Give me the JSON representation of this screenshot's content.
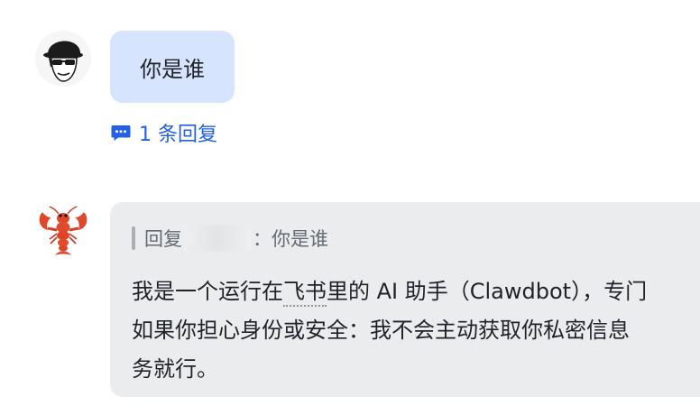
{
  "messages": {
    "user": {
      "avatar_icon": "user-avatar-sunglasses-hat-icon",
      "text": "你是谁",
      "reply_count_label": "1 条回复"
    },
    "bot": {
      "avatar_icon": "lobster-avatar-icon",
      "quote": {
        "prefix": "回复",
        "suffix": "：你是谁"
      },
      "lines": [
        {
          "before": "我是一个运行在",
          "underlined": "飞书",
          "after": "里的 AI 助手（Clawdbot），专门"
        },
        {
          "text": "如果你担心身份或安全：我不会主动获取你私密信息"
        },
        {
          "text": "务就行。"
        }
      ]
    }
  },
  "colors": {
    "user_bubble": "#d6e4fd",
    "bot_bubble": "#ebecee",
    "link_blue": "#2360e6",
    "quote_gray": "#646a73",
    "text_primary": "#1f2329"
  }
}
